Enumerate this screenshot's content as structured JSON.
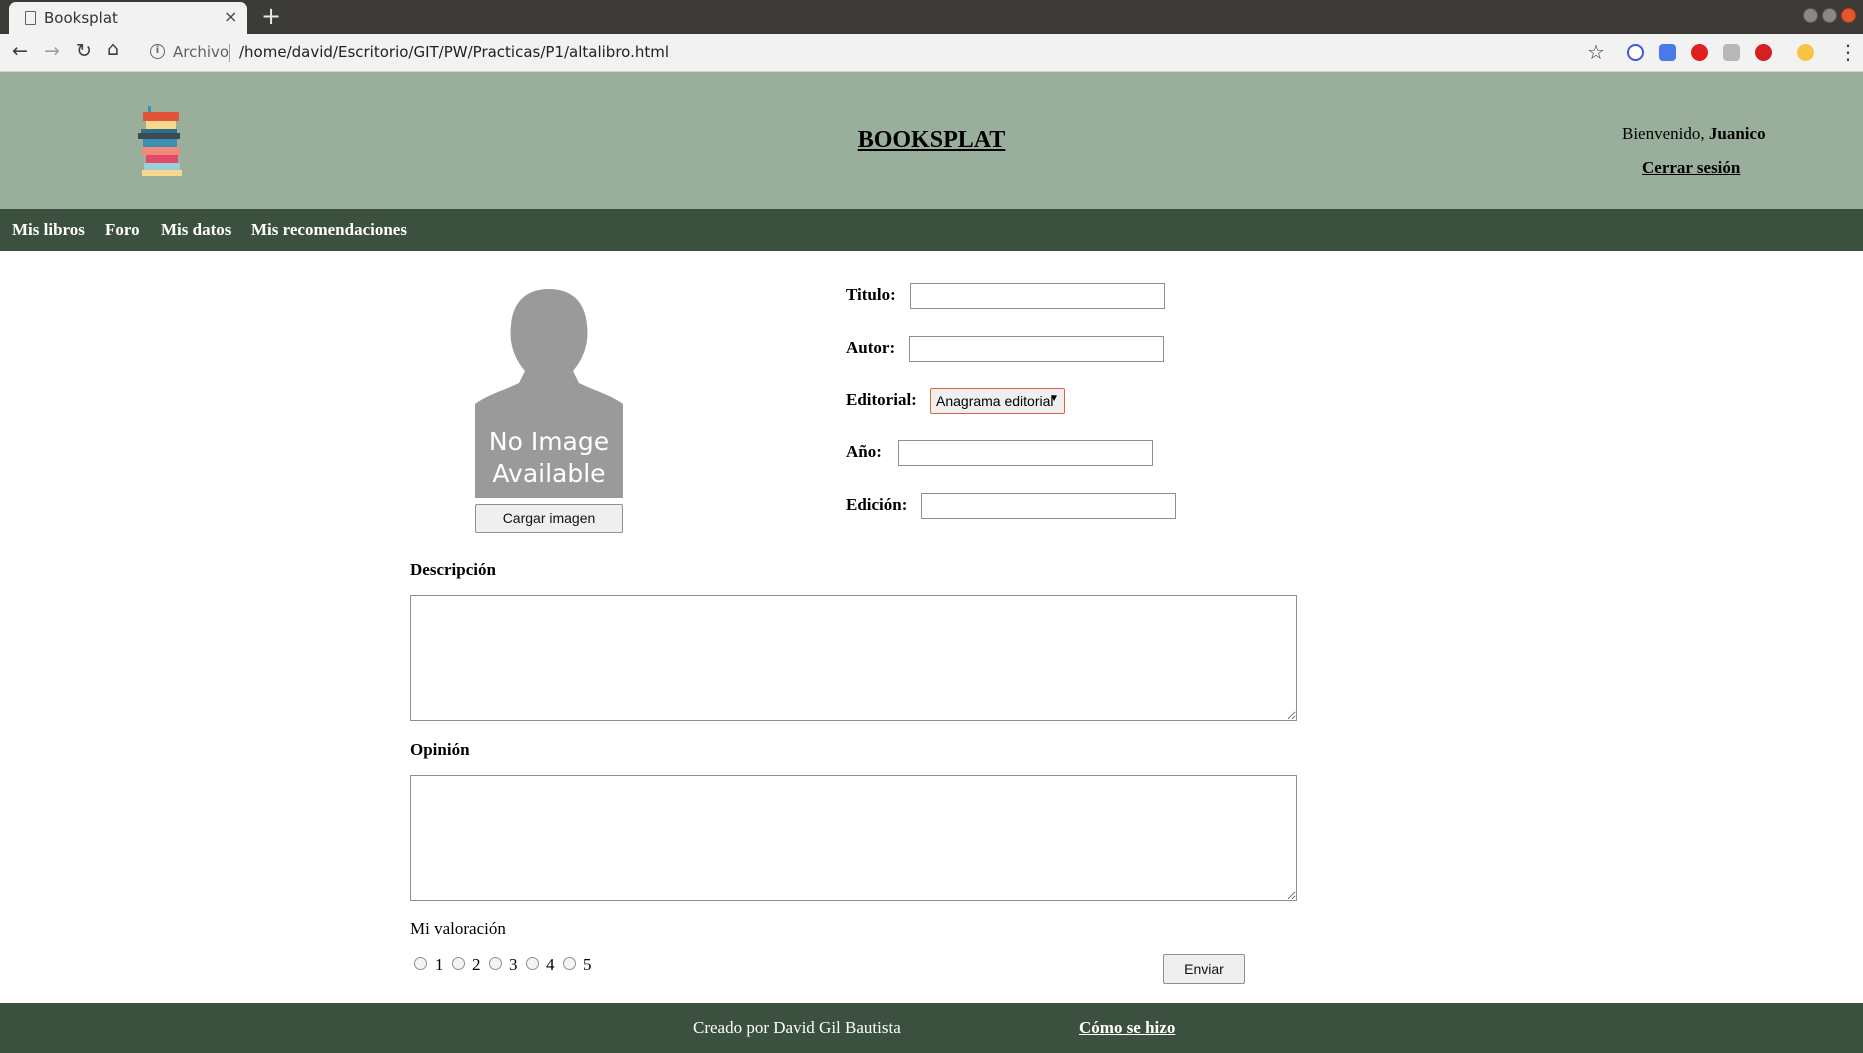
{
  "browser": {
    "tab_title": "Booksplat",
    "tab_close": "×",
    "new_tab": "+",
    "omnibox_scheme": "Archivo",
    "url": "/home/david/Escritorio/GIT/PW/Practicas/P1/altalibro.html",
    "icons": [
      "page-icon",
      "back-icon",
      "forward-icon",
      "reload-icon",
      "home-icon",
      "info-icon",
      "star-icon",
      "menu-icon"
    ]
  },
  "header": {
    "title": "BOOKSPLAT",
    "welcome_prefix": "Bienvenido, ",
    "user_name": "Juanico",
    "logout": "Cerrar sesión",
    "background": "#9aae9c"
  },
  "nav": {
    "items": [
      "Mis libros",
      "Foro",
      "Mis datos",
      "Mis recomendaciones"
    ],
    "background": "#3c5040"
  },
  "form": {
    "image_placeholder": [
      "No Image",
      "Available"
    ],
    "upload_button": "Cargar imagen",
    "title_label": "Titulo:",
    "title_value": "",
    "author_label": "Autor:",
    "author_value": "",
    "publisher_label": "Editorial:",
    "publisher_selected": "Anagrama editorial",
    "year_label": "Año:",
    "year_value": "",
    "edition_label": "Edición:",
    "edition_value": "",
    "description_label": "Descripción",
    "description_value": "",
    "opinion_label": "Opinión",
    "opinion_value": "",
    "rating_label": "Mi valoración",
    "rating_options": [
      "1",
      "2",
      "3",
      "4",
      "5"
    ],
    "submit_button": "Enviar"
  },
  "footer": {
    "credits": "Creado por David Gil Bautista",
    "how_link": "Cómo se hizo"
  }
}
